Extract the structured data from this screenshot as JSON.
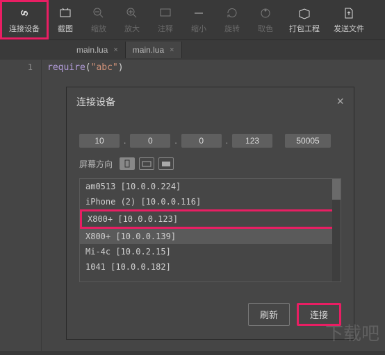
{
  "toolbar": [
    {
      "label": "连接设备",
      "icon": "link-icon",
      "active": true,
      "dim": false
    },
    {
      "label": "截图",
      "icon": "screenshot-icon",
      "dim": false
    },
    {
      "label": "缩放",
      "icon": "zoom-out-icon",
      "dim": true
    },
    {
      "label": "放大",
      "icon": "zoom-in-icon",
      "dim": true
    },
    {
      "label": "注释",
      "icon": "comment-icon",
      "dim": true
    },
    {
      "label": "缩小",
      "icon": "minimize-icon",
      "dim": true
    },
    {
      "label": "旋转",
      "icon": "rotate-icon",
      "dim": true
    },
    {
      "label": "取色",
      "icon": "color-picker-icon",
      "dim": true
    },
    {
      "label": "打包工程",
      "icon": "package-icon",
      "dim": false
    },
    {
      "label": "发送文件",
      "icon": "send-file-icon",
      "dim": false
    }
  ],
  "tabs": [
    {
      "name": "main.lua",
      "active": false
    },
    {
      "name": "main.lua",
      "active": true
    }
  ],
  "editor": {
    "line": "1",
    "code": {
      "keyword": "require",
      "paren_open": "(",
      "string": "\"abc\"",
      "paren_close": ")"
    }
  },
  "dialog": {
    "title": "连接设备",
    "close": "×",
    "ip": [
      "10",
      "0",
      "0",
      "123"
    ],
    "port": "50005",
    "orientation_label": "屏幕方向",
    "devices": [
      "am0513 [10.0.0.224]",
      "iPhone (2) [10.0.0.116]",
      "X800+ [10.0.0.123]",
      "X800+ [10.0.0.139]",
      "Mi-4c [10.0.2.15]",
      "1041 [10.0.0.182]"
    ],
    "highlighted_index": 2,
    "selected_index": 3,
    "refresh": "刷新",
    "connect": "连接"
  },
  "watermark": "下载吧"
}
